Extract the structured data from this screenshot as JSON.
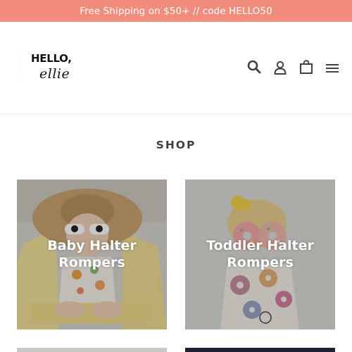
{
  "announcement": {
    "text": "Free Shipping on $50+ // code HELLO50",
    "bg_color": "#f28d7d"
  },
  "header": {
    "logo_hello": "HELLO,",
    "logo_ellie": "ellie",
    "icons": [
      "search-icon",
      "account-icon",
      "cart-icon",
      "menu-icon"
    ]
  },
  "main": {
    "section_title": "SHOP",
    "collections": [
      {
        "title": "Baby Halter Rompers"
      },
      {
        "title": "Toddler Halter Rompers"
      }
    ]
  }
}
